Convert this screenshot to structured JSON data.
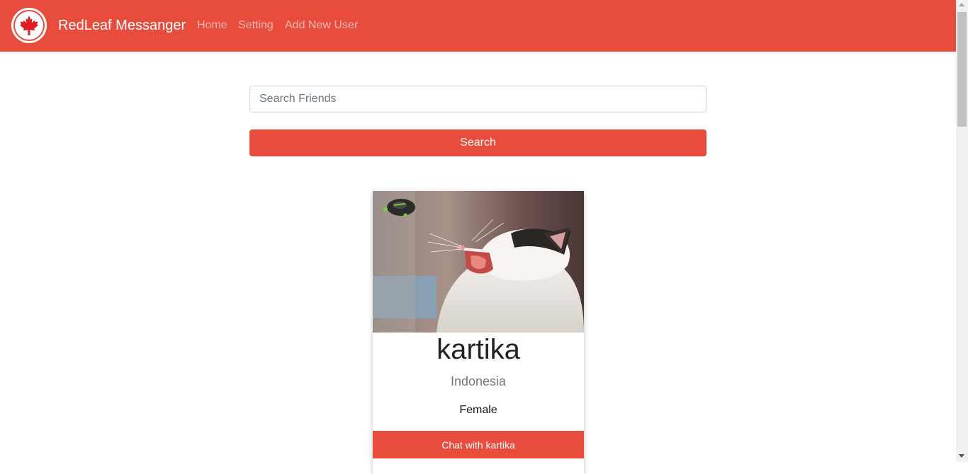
{
  "navbar": {
    "brand": "RedLeaf Messanger",
    "links": [
      "Home",
      "Setting",
      "Add New User"
    ],
    "logo_icon": "maple-leaf-icon",
    "color": "#e74c3c"
  },
  "search": {
    "placeholder": "Search Friends",
    "value": "",
    "button_label": "Search"
  },
  "results": [
    {
      "name": "kartika",
      "country": "Indonesia",
      "gender": "Female",
      "photo": "yawning-cat-photo",
      "chat_label": "Chat with kartika"
    }
  ]
}
